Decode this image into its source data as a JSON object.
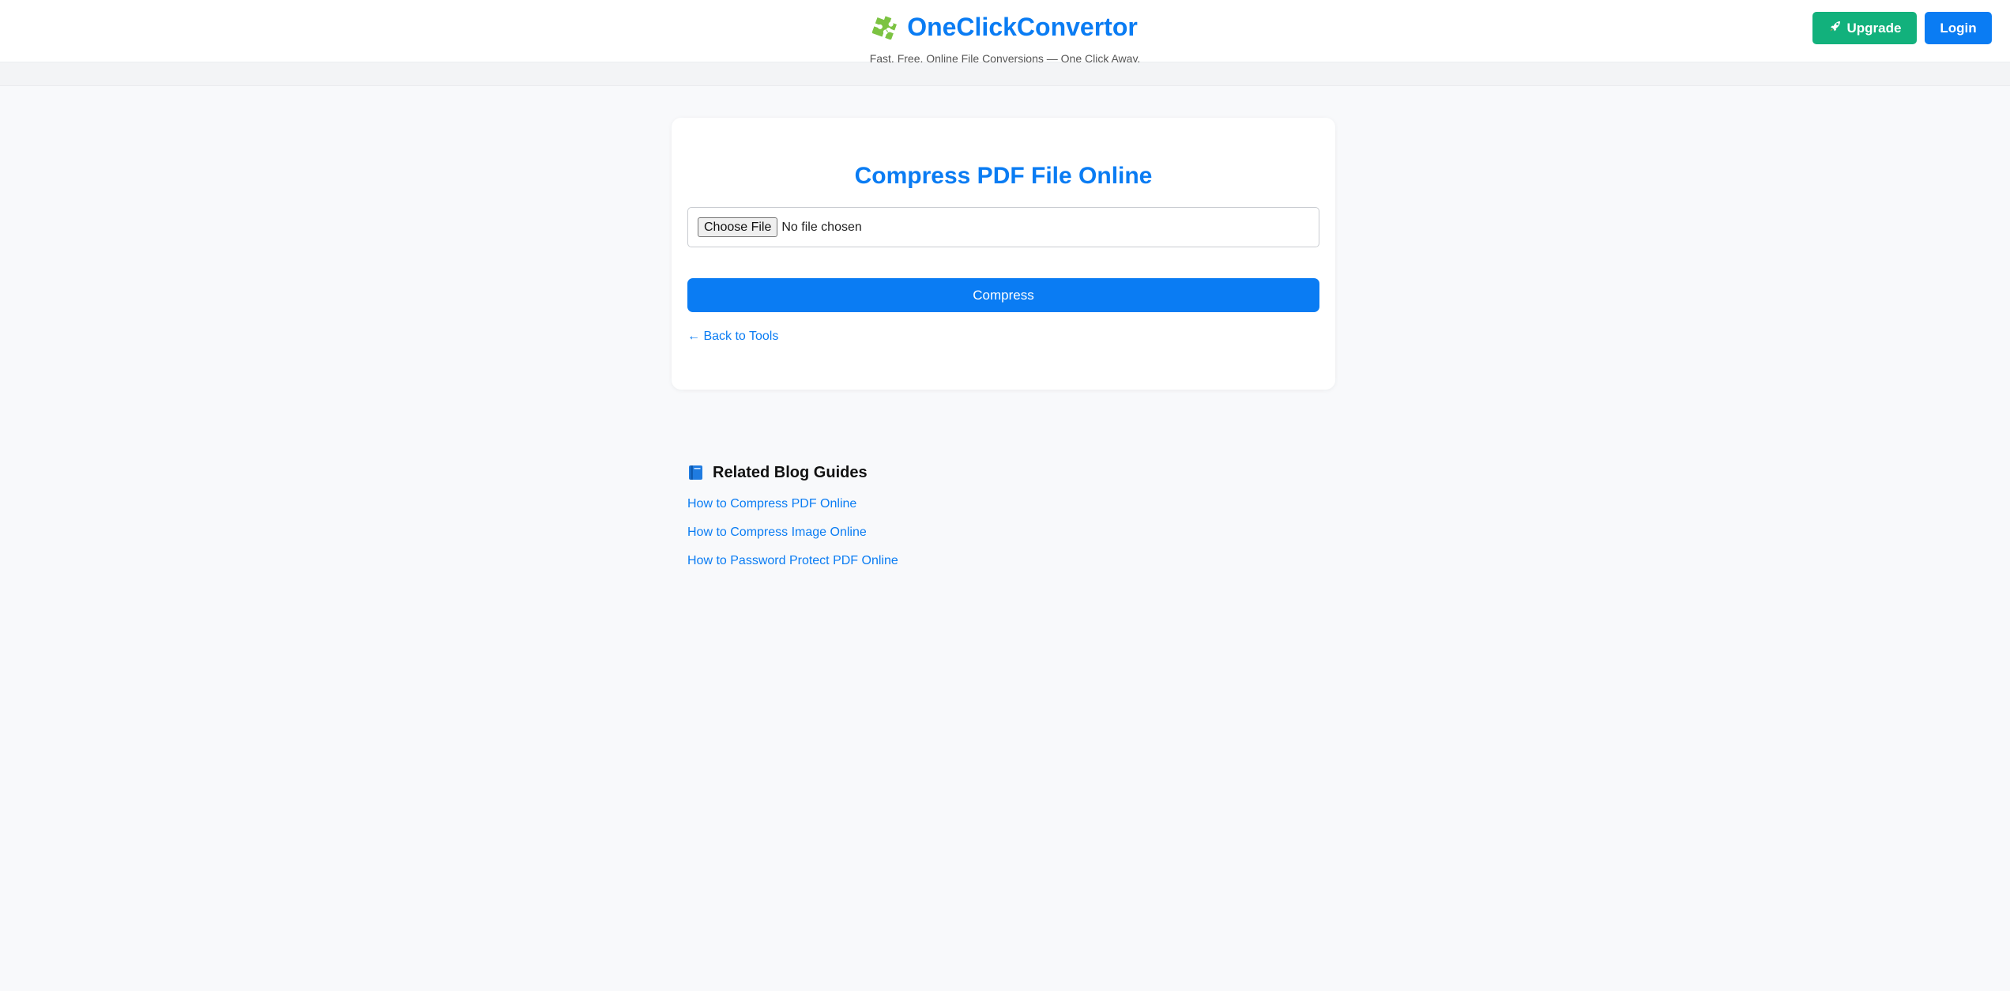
{
  "header": {
    "brand_icon": "puzzle-icon",
    "title": "OneClickConvertor",
    "tagline": "Fast. Free. Online File Conversions — One Click Away.",
    "upgrade_icon": "rocket-icon",
    "upgrade_label": "Upgrade",
    "login_label": "Login"
  },
  "tool": {
    "title": "Compress PDF File Online",
    "file_button_label": "Choose File",
    "file_status": "No file chosen",
    "submit_label": "Compress",
    "back_link": "← Back to Tools"
  },
  "related": {
    "icon": "book-icon",
    "heading": "Related Blog Guides",
    "links": [
      {
        "label": "How to Compress PDF Online"
      },
      {
        "label": "How to Compress Image Online"
      },
      {
        "label": "How to Password Protect PDF Online"
      }
    ]
  },
  "colors": {
    "accent": "#0a7cf3",
    "upgrade": "#12b17c",
    "background": "#f8f9fb"
  }
}
